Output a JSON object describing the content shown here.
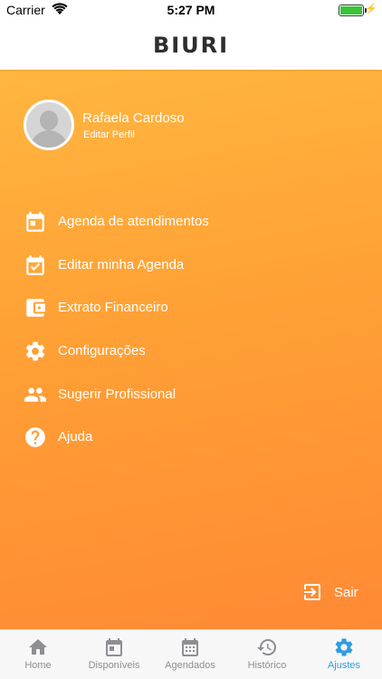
{
  "status_bar": {
    "carrier": "Carrier",
    "time": "5:27 PM",
    "battery_level": 1.0,
    "battery_color": "#3bc43b"
  },
  "header": {
    "logo_text": "BIURI"
  },
  "profile": {
    "name": "Rafaela Cardoso",
    "edit_label": "Editar Perfil"
  },
  "menu": {
    "items": [
      {
        "label": "Agenda de atendimentos",
        "icon": "calendar-icon"
      },
      {
        "label": "Editar minha Agenda",
        "icon": "calendar-check-icon"
      },
      {
        "label": "Extrato Financeiro",
        "icon": "wallet-icon"
      },
      {
        "label": "Configurações",
        "icon": "gear-icon"
      },
      {
        "label": "Sugerir Profissional",
        "icon": "people-icon"
      },
      {
        "label": "Ajuda",
        "icon": "help-icon"
      }
    ]
  },
  "logout": {
    "label": "Sair",
    "icon": "exit-icon"
  },
  "tabbar": {
    "active_color": "#2f9ee0",
    "inactive_color": "#8e8e93",
    "tabs": [
      {
        "label": "Home",
        "icon": "home-icon",
        "active": false
      },
      {
        "label": "Disponíveis",
        "icon": "calendar-icon",
        "active": false
      },
      {
        "label": "Agendados",
        "icon": "calendar-grid-icon",
        "active": false
      },
      {
        "label": "Histórico",
        "icon": "history-icon",
        "active": false
      },
      {
        "label": "Ajustes",
        "icon": "gear-icon",
        "active": true
      }
    ]
  },
  "colors": {
    "gradient_top": "#ffb640",
    "gradient_bottom": "#ff8a35"
  }
}
